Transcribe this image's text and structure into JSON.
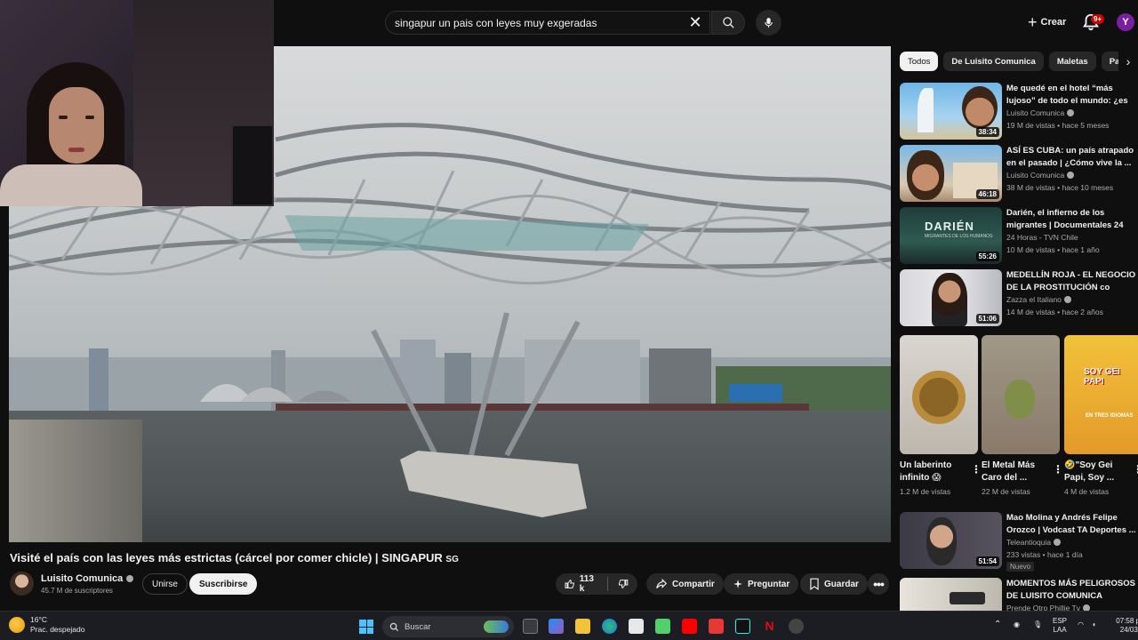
{
  "search": {
    "query": "singapur un pais con leyes muy exgeradas"
  },
  "header": {
    "create_label": "Crear",
    "notifications_badge": "9+",
    "avatar_letter": "Y"
  },
  "video": {
    "title": "Visité el país con las leyes más estrictas (cárcel por comer chicle) | SINGAPUR",
    "title_flag": "SG",
    "channel": "Luisito Comunica",
    "subscribers": "45.7 M de suscriptores",
    "join_label": "Unirse",
    "subscribe_label": "Suscribirse",
    "likes": "113 k",
    "share_label": "Compartir",
    "ask_label": "Preguntar",
    "save_label": "Guardar"
  },
  "chips": [
    "Todos",
    "De Luisito Comunica",
    "Maletas",
    "Par"
  ],
  "recommendations": [
    {
      "title": "Me quedé en el hotel “más lujoso” de todo el mundo: ¿es ...",
      "channel": "Luisito Comunica",
      "verified": true,
      "meta": "19 M de vistas • hace 5 meses",
      "duration": "38:34",
      "new": ""
    },
    {
      "title": "ASÍ ES CUBA: un país atrapado en el pasado | ¿Cómo vive la ...",
      "channel": "Luisito Comunica",
      "verified": true,
      "meta": "38 M de vistas • hace 10 meses",
      "duration": "46:18",
      "new": ""
    },
    {
      "title": "Darién, el infierno de los migrantes | Documentales 24",
      "channel": "24 Horas - TVN Chile",
      "verified": false,
      "meta": "10 M de vistas • hace 1 año",
      "duration": "55:26",
      "new": ""
    },
    {
      "title": "MEDELLÍN ROJA - EL NEGOCIO DE LA PROSTITUCIÓN co",
      "channel": "Zazza el Italiano",
      "verified": true,
      "meta": "14 M de vistas • hace 2 años",
      "duration": "51:06",
      "new": ""
    },
    {
      "title": "Mao Molina y Andrés Felipe Orozco | Vodcast TA Deportes ...",
      "channel": "Teleantioquia",
      "verified": true,
      "meta": "233 vistas • hace 1 día",
      "duration": "51:54",
      "new": "Nuevo"
    },
    {
      "title": "MOMENTOS MÁS PELIGROSOS DE LUISITO COMUNICA",
      "channel": "Prende Otro Phillie Tv",
      "verified": true,
      "meta": "",
      "duration": "",
      "new": ""
    }
  ],
  "thumb_labels": {
    "darien": "DARIÉN",
    "darien_sub": "MIGRANTES DE LOS HUMANOS",
    "soygei": "SOY GEI PAPI",
    "tresidiomas": "EN TRES IDIOMAS"
  },
  "shorts": [
    {
      "title": "Un laberinto infinito 😱",
      "views": "1.2 M de vistas"
    },
    {
      "title": "El Metal Más Caro del ...",
      "views": "22 M de vistas"
    },
    {
      "title": "🤣\"Soy Gei Papi, Soy ...",
      "views": "4 M de vistas"
    }
  ],
  "taskbar": {
    "temperature": "16°C",
    "weather": "Prac. despejado",
    "search_label": "Buscar",
    "lang_top": "ESP",
    "lang_bottom": "LAA",
    "time": "07:58 p",
    "date": "24/03/"
  },
  "colors": {
    "background": "#0f0f0f",
    "accent_red": "#cc0000",
    "chip_bg": "#272727",
    "text": "#f1f1f1",
    "muted": "#aaaaaa"
  }
}
